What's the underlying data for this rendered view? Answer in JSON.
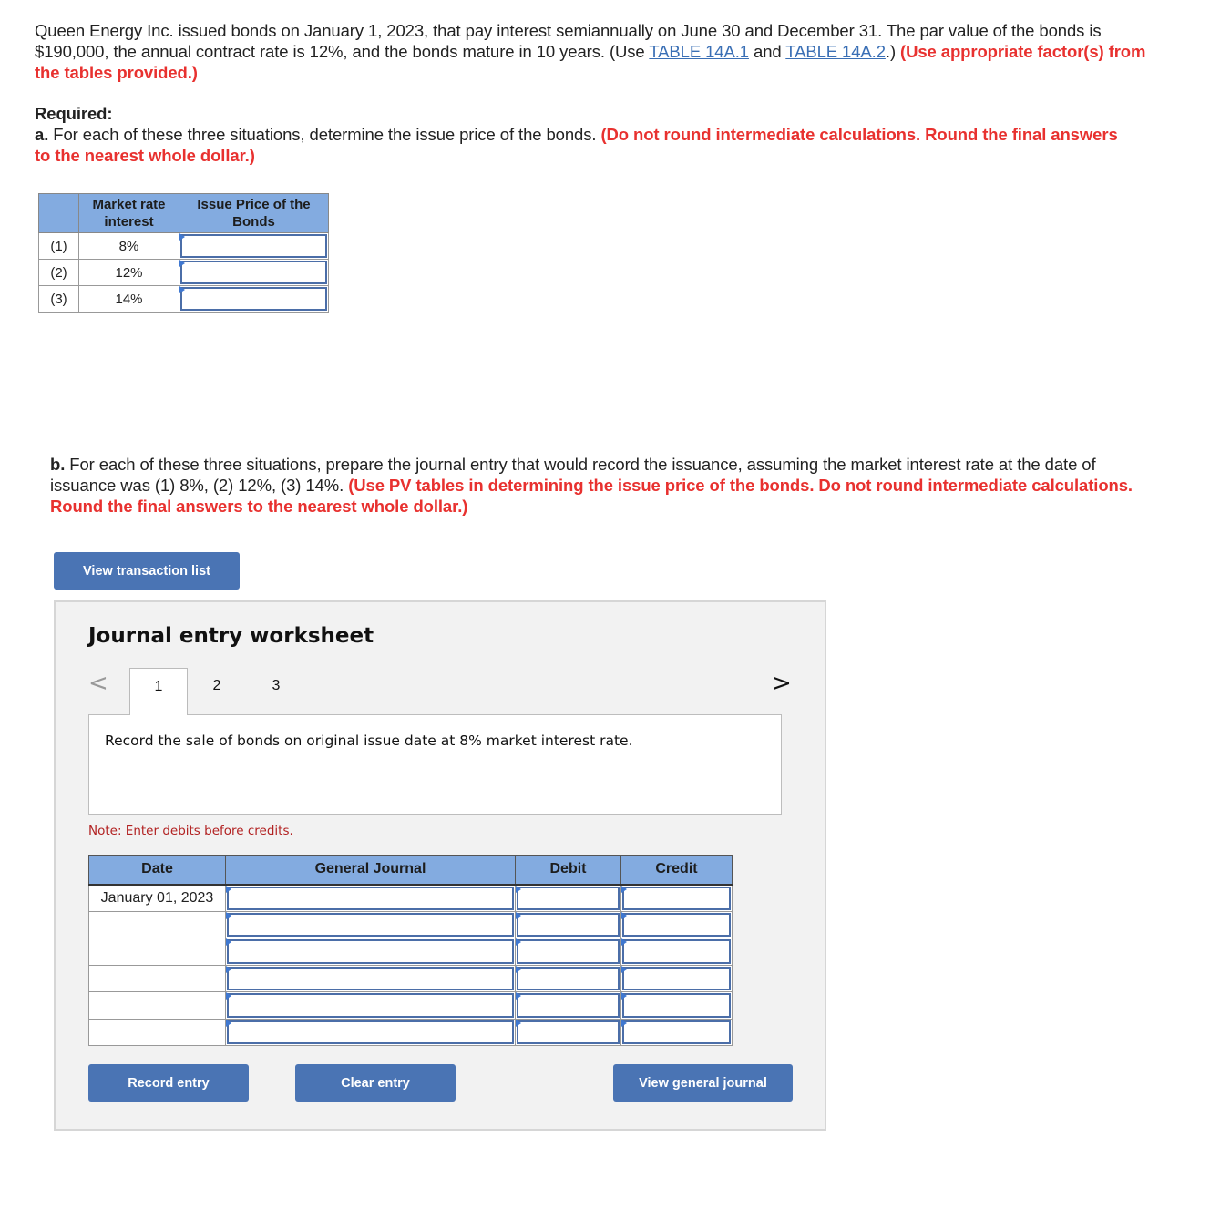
{
  "intro": {
    "text_1": "Queen Energy Inc. issued bonds on January 1, 2023, that pay interest semiannually on June 30 and December 31. The par value of the bonds is $190,000, the annual contract rate is 12%, and the bonds mature in 10 years. (Use ",
    "link_1": "TABLE 14A.1",
    "text_and": " and ",
    "link_2": "TABLE 14A.2",
    "text_after": ".) ",
    "instruction": "(Use appropriate factor(s) from the tables provided.)"
  },
  "required": {
    "heading": "Required:",
    "part_a_label": "a.",
    "part_a_text": " For each of these three situations, determine the issue price of the bonds. ",
    "part_a_instruction": "(Do not round intermediate calculations. Round the final answers to the nearest whole dollar.)"
  },
  "part_a_table": {
    "headers": [
      "",
      "Market rate interest",
      "Issue Price of the Bonds"
    ],
    "rows": [
      {
        "num": "(1)",
        "rate": "8%",
        "issue_price": ""
      },
      {
        "num": "(2)",
        "rate": "12%",
        "issue_price": ""
      },
      {
        "num": "(3)",
        "rate": "14%",
        "issue_price": ""
      }
    ]
  },
  "part_b": {
    "label": "b.",
    "text": " For each of these three situations, prepare the journal entry that would record the issuance, assuming the market interest rate at the date of issuance was (1) 8%, (2) 12%, (3) 14%. ",
    "instruction": "(Use PV tables in determining the issue price of the bonds. Do not round intermediate calculations. Round the final answers to the nearest whole dollar.)"
  },
  "buttons": {
    "view_transaction_list": "View transaction list",
    "record_entry": "Record entry",
    "clear_entry": "Clear entry",
    "view_general_journal": "View general journal"
  },
  "worksheet": {
    "title": "Journal entry worksheet",
    "prev_icon": "<",
    "next_icon": ">",
    "tabs": [
      "1",
      "2",
      "3"
    ],
    "active_tab": "1",
    "description": "Record the sale of bonds on original issue date at 8% market interest rate.",
    "note": "Note: Enter debits before credits.",
    "journal": {
      "headers": [
        "Date",
        "General Journal",
        "Debit",
        "Credit"
      ],
      "rows": [
        {
          "date": "January 01, 2023",
          "account": "",
          "debit": "",
          "credit": ""
        },
        {
          "date": "",
          "account": "",
          "debit": "",
          "credit": ""
        },
        {
          "date": "",
          "account": "",
          "debit": "",
          "credit": ""
        },
        {
          "date": "",
          "account": "",
          "debit": "",
          "credit": ""
        },
        {
          "date": "",
          "account": "",
          "debit": "",
          "credit": ""
        },
        {
          "date": "",
          "account": "",
          "debit": "",
          "credit": ""
        }
      ]
    }
  },
  "colors": {
    "accent_button": "#4a74b4",
    "header_blue": "#83abe0",
    "instruction_red": "#e8312f",
    "link_blue": "#3a6fb5",
    "note_red": "#b22222"
  }
}
